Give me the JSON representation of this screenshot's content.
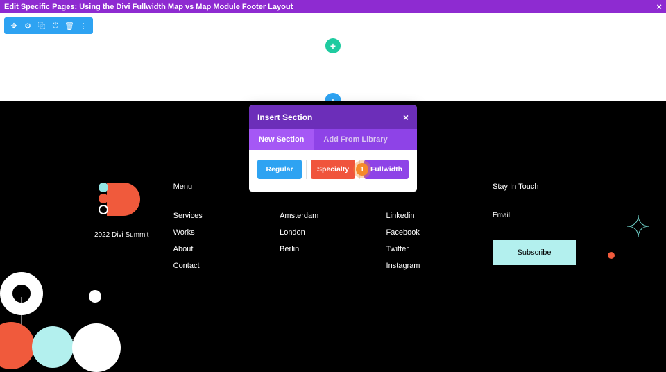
{
  "topBar": {
    "title": "Edit Specific Pages: Using the Divi Fullwidth Map vs Map Module Footer Layout"
  },
  "modal": {
    "title": "Insert Section",
    "tabs": {
      "new": "New Section",
      "library": "Add From Library"
    },
    "buttons": {
      "regular": "Regular",
      "specialty": "Specialty",
      "fullwidth": "Fullwidth"
    },
    "marker": "1"
  },
  "footer": {
    "logoTag": "2022 Divi Summit",
    "menu": {
      "heading": "Menu",
      "items": [
        "Services",
        "Works",
        "About",
        "Contact"
      ]
    },
    "locations": [
      "Amsterdam",
      "London",
      "Berlin"
    ],
    "social": [
      "Linkedin",
      "Facebook",
      "Twitter",
      "Instagram"
    ],
    "stay": {
      "heading": "Stay In Touch",
      "emailLabel": "Email",
      "subscribe": "Subscribe"
    }
  }
}
